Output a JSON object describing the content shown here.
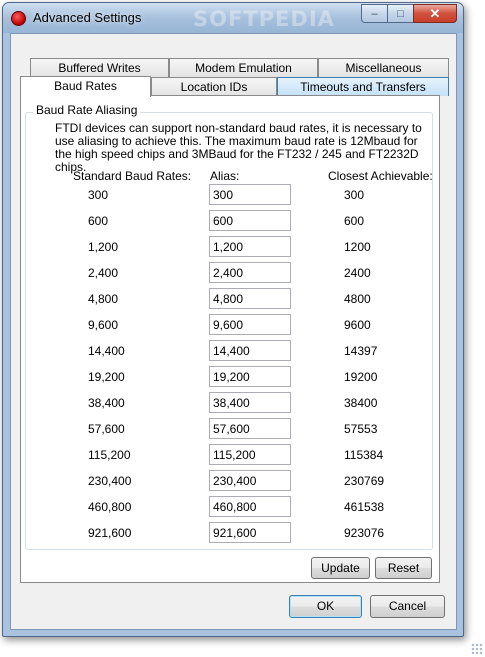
{
  "window": {
    "title": "Advanced Settings",
    "watermark": "SOFTPEDIA"
  },
  "caption_buttons": {
    "minimize": "–",
    "maximize": "□",
    "close": "✕"
  },
  "tabs": {
    "row1": [
      "Buffered Writes",
      "Modem Emulation",
      "Miscellaneous"
    ],
    "row2": [
      "Baud Rates",
      "Location IDs",
      "Timeouts and Transfers"
    ],
    "active": "Baud Rates",
    "hovered": "Timeouts and Transfers"
  },
  "group": {
    "title": "Baud Rate Aliasing",
    "description": "FTDI devices can support non-standard baud rates, it is necessary to use aliasing to achieve this. The maximum baud rate is 12Mbaud for the high speed chips and 3MBaud for the FT232 / 245 and FT2232D chips."
  },
  "columns": {
    "standard": "Standard Baud Rates:",
    "alias": "Alias:",
    "achievable": "Closest Achievable:"
  },
  "rows": [
    {
      "standard": "300",
      "alias": "300",
      "achievable": "300"
    },
    {
      "standard": "600",
      "alias": "600",
      "achievable": "600"
    },
    {
      "standard": "1,200",
      "alias": "1,200",
      "achievable": "1200"
    },
    {
      "standard": "2,400",
      "alias": "2,400",
      "achievable": "2400"
    },
    {
      "standard": "4,800",
      "alias": "4,800",
      "achievable": "4800"
    },
    {
      "standard": "9,600",
      "alias": "9,600",
      "achievable": "9600"
    },
    {
      "standard": "14,400",
      "alias": "14,400",
      "achievable": "14397"
    },
    {
      "standard": "19,200",
      "alias": "19,200",
      "achievable": "19200"
    },
    {
      "standard": "38,400",
      "alias": "38,400",
      "achievable": "38400"
    },
    {
      "standard": "57,600",
      "alias": "57,600",
      "achievable": "57553"
    },
    {
      "standard": "115,200",
      "alias": "115,200",
      "achievable": "115384"
    },
    {
      "standard": "230,400",
      "alias": "230,400",
      "achievable": "230769"
    },
    {
      "standard": "460,800",
      "alias": "460,800",
      "achievable": "461538"
    },
    {
      "standard": "921,600",
      "alias": "921,600",
      "achievable": "923076"
    }
  ],
  "buttons": {
    "update": "Update",
    "reset": "Reset",
    "ok": "OK",
    "cancel": "Cancel"
  }
}
